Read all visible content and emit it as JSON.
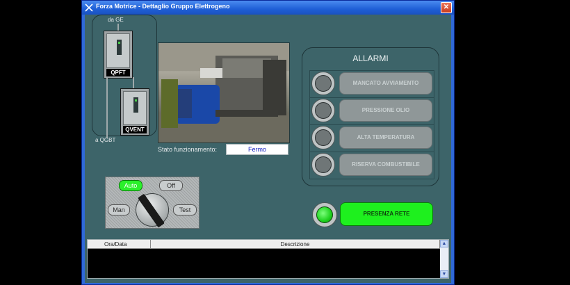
{
  "window": {
    "title": "Forza Motrice - Dettaglio Gruppo Elettrogeno",
    "close": "✕"
  },
  "breakers": {
    "top_label": "da GE",
    "bottom_label": "a QGBT",
    "cabinet1": "QPFT",
    "cabinet2": "QVENT"
  },
  "status": {
    "label": "Stato funzionamento:",
    "value": "Fermo"
  },
  "alarms": {
    "title": "ALLARMI",
    "items": [
      {
        "label": "MANCATO AVVIAMENTO"
      },
      {
        "label": "PRESSIONE OLIO"
      },
      {
        "label": "ALTA TEMPERATURA"
      },
      {
        "label": "RISERVA COMBUSTIBILE"
      }
    ]
  },
  "rete": {
    "label": "PRESENZA RETE",
    "color": "#1ef01e"
  },
  "selector": {
    "positions": {
      "auto": "Auto",
      "off": "Off",
      "man": "Man",
      "test": "Test"
    },
    "selected": "Auto"
  },
  "events": {
    "columns": [
      "Ora/Data",
      "Descrizione"
    ],
    "scroll_up": "▲",
    "scroll_down": "▼"
  }
}
